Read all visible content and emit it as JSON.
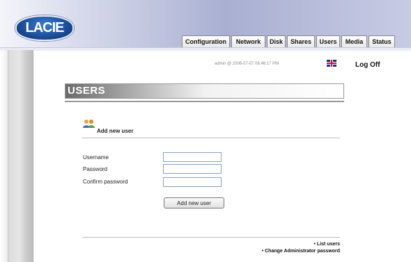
{
  "header": {
    "logo_text": "LACIE",
    "tabs": [
      {
        "label": "Configuration"
      },
      {
        "label": "Network"
      },
      {
        "label": "Disk"
      },
      {
        "label": "Shares"
      },
      {
        "label": "Users"
      },
      {
        "label": "Media"
      },
      {
        "label": "Status"
      }
    ]
  },
  "status": {
    "text": "admin @ 2006-07-07 06:46:17 PM",
    "flag_icon": "uk-flag-icon",
    "logoff_label": "Log Off"
  },
  "page": {
    "title": "USERS"
  },
  "section": {
    "icon": "users-icon",
    "title": "Add new user"
  },
  "form": {
    "username_label": "Username",
    "username_value": "",
    "password_label": "Password",
    "password_value": "",
    "confirm_label": "Confirm password",
    "confirm_value": "",
    "submit_label": "Add new user"
  },
  "links": {
    "list_users": "• List users",
    "change_admin_password": "• Change Administrator password"
  }
}
